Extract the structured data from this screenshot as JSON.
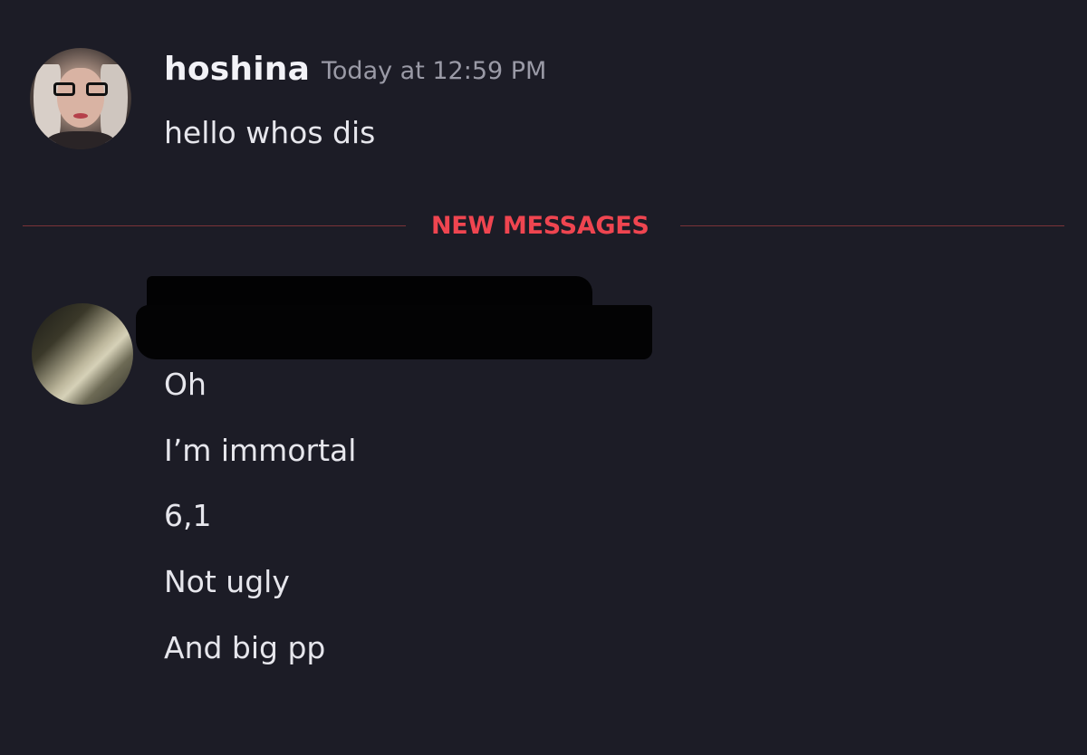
{
  "messages": [
    {
      "author": "hoshina",
      "timestamp": "Today at 12:59 PM",
      "lines": [
        "hello whos dis"
      ]
    },
    {
      "author": "",
      "timestamp": "",
      "lines": [
        "Oh",
        "I’m immortal",
        "6,1",
        "Not ugly",
        "And big pp"
      ]
    }
  ],
  "divider": {
    "label": "NEW MESSAGES"
  },
  "colors": {
    "background": "#1c1c26",
    "new_messages_accent": "#ef4550",
    "username": "#f2f2f7",
    "timestamp": "#9a9aa6"
  },
  "icons": {
    "author1_avatar": "user-avatar-photo",
    "author2_avatar": "user-avatar-photo",
    "redaction": "redacted-username-block"
  }
}
